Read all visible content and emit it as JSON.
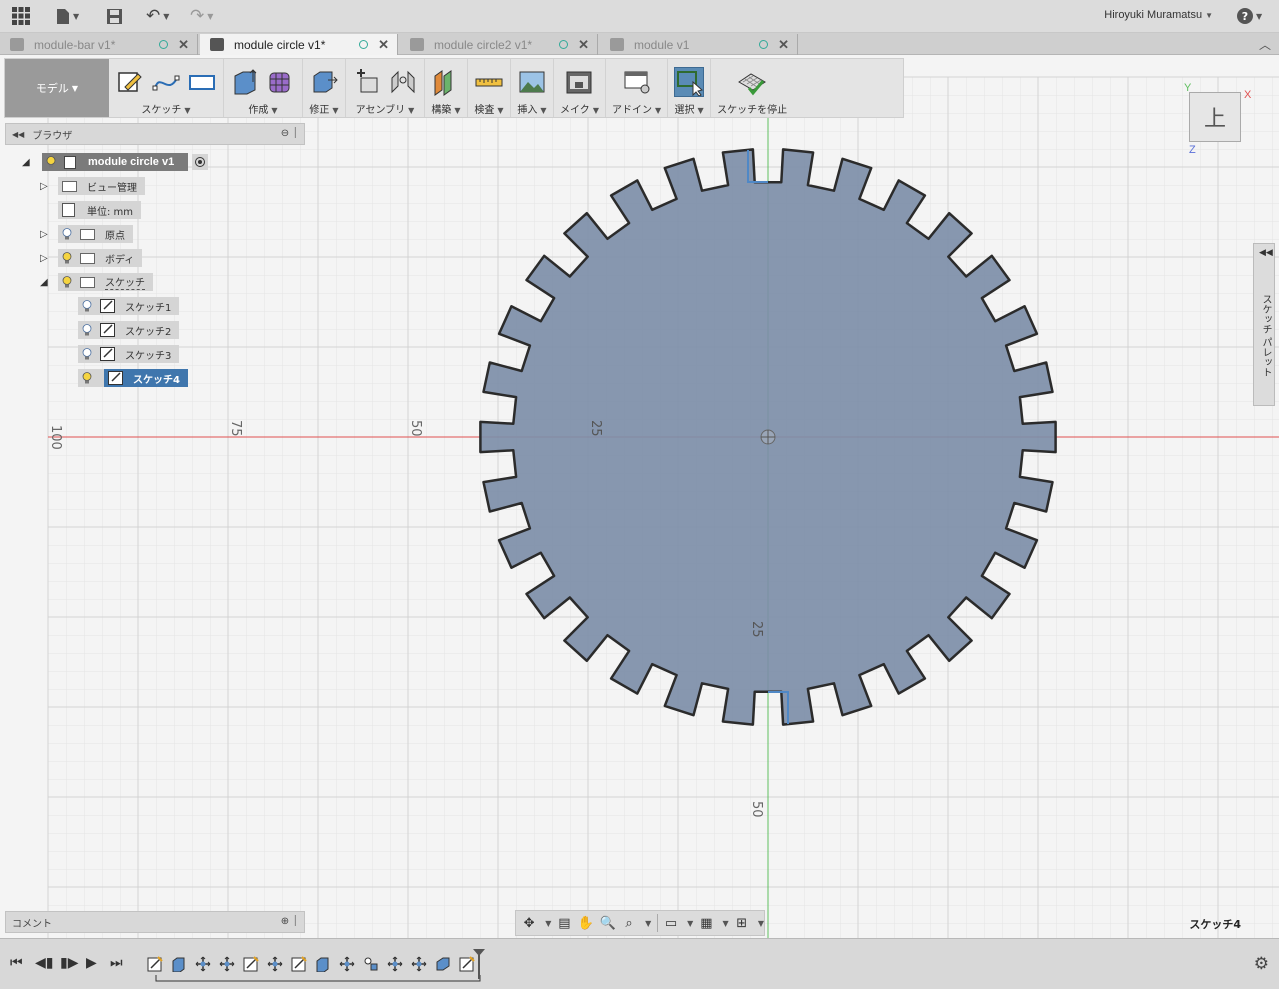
{
  "appbar": {
    "user": "Hiroyuki Muramatsu",
    "help": "?"
  },
  "tabs": [
    {
      "label": "module-bar v1*",
      "active": false
    },
    {
      "label": "module circle v1*",
      "active": true
    },
    {
      "label": "module circle2 v1*",
      "active": false
    },
    {
      "label": "module v1",
      "active": false
    }
  ],
  "toolbar": {
    "workspace": "モデル",
    "groups": [
      {
        "label": "スケッチ"
      },
      {
        "label": "作成"
      },
      {
        "label": "修正"
      },
      {
        "label": "アセンブリ"
      },
      {
        "label": "構築"
      },
      {
        "label": "検査"
      },
      {
        "label": "挿入"
      },
      {
        "label": "メイク"
      },
      {
        "label": "アドイン"
      },
      {
        "label": "選択"
      },
      {
        "label": "スケッチを停止"
      }
    ]
  },
  "browser": {
    "title": "ブラウザ",
    "root": "module circle v1",
    "items": [
      {
        "label": "ビュー管理"
      },
      {
        "label": "単位: mm"
      },
      {
        "label": "原点"
      },
      {
        "label": "ボディ"
      },
      {
        "label": "スケッチ"
      }
    ],
    "sketches": [
      {
        "label": "スケッチ1"
      },
      {
        "label": "スケッチ2"
      },
      {
        "label": "スケッチ3"
      },
      {
        "label": "スケッチ4"
      }
    ]
  },
  "canvas": {
    "axis_labels": [
      "100",
      "75",
      "50",
      "25",
      "25",
      "50"
    ]
  },
  "comment": {
    "label": "コメント"
  },
  "palette": {
    "label": "スケッチ パレット"
  },
  "viewcube": {
    "face": "上",
    "x": "X",
    "y": "Y",
    "z": "Z"
  },
  "status": {
    "active_sketch": "スケッチ4"
  },
  "colors": {
    "accent": "#3f76ad",
    "gear_fill": "#7d8ea8",
    "gear_stroke": "#2b2b2b",
    "x_axis": "#e05050",
    "y_axis": "#5fbf5f"
  }
}
